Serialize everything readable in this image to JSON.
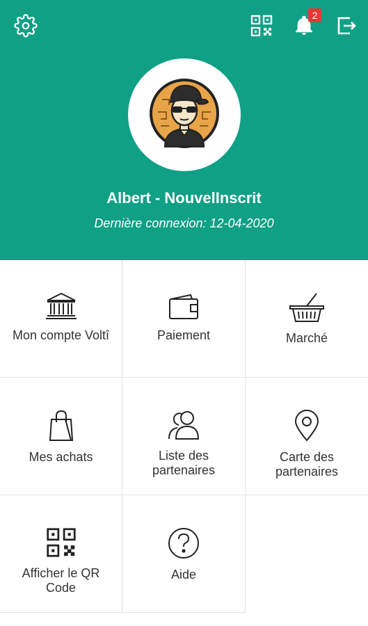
{
  "header": {
    "bg_color": "#0fa085",
    "icons": [
      "gear-icon",
      "qr-code-icon",
      "bell-icon",
      "logout-icon"
    ],
    "notification_count": "2",
    "user_name": "Albert - NouvelInscrit",
    "last_login": "Dernière connexion: 12-04-2020"
  },
  "menu": {
    "items": [
      {
        "label": "Mon compte Voltî",
        "icon": "bank-icon"
      },
      {
        "label": "Paiement",
        "icon": "wallet-icon"
      },
      {
        "label": "Marché",
        "icon": "basket-icon"
      },
      {
        "label": "Mes achats",
        "icon": "shopping-bag-icon"
      },
      {
        "label": "Liste des partenaires",
        "icon": "people-icon"
      },
      {
        "label": "Carte des partenaires",
        "icon": "map-pin-icon"
      },
      {
        "label": "Afficher le QR Code",
        "icon": "qr-code-icon"
      },
      {
        "label": "Aide",
        "icon": "help-icon"
      }
    ]
  }
}
